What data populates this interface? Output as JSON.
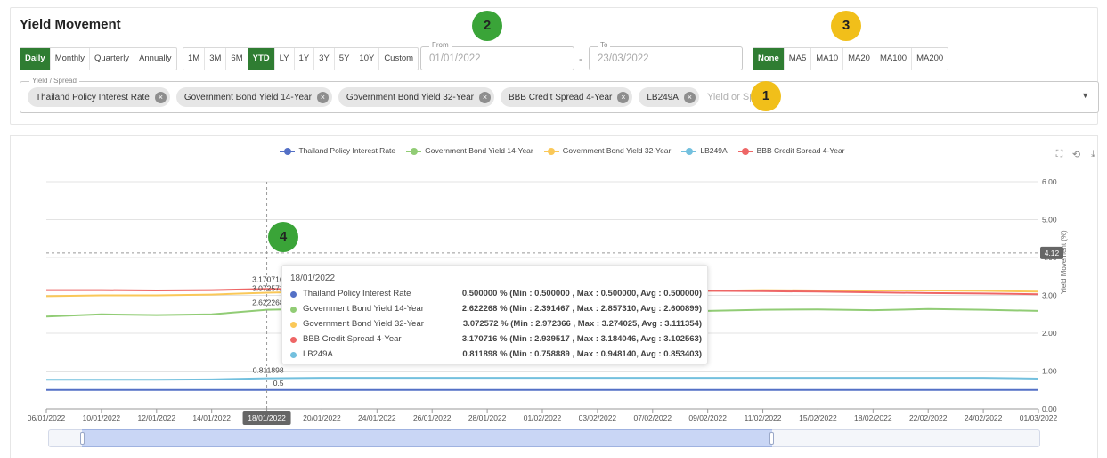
{
  "header": {
    "title": "Yield Movement"
  },
  "frequency_buttons": [
    "Daily",
    "Monthly",
    "Quarterly",
    "Annually"
  ],
  "frequency_active": "Daily",
  "period_buttons": [
    "1M",
    "3M",
    "6M",
    "YTD",
    "LY",
    "1Y",
    "3Y",
    "5Y",
    "10Y",
    "Custom"
  ],
  "period_active": "YTD",
  "date_range": {
    "from_label": "From",
    "from_value": "01/01/2022",
    "to_label": "To",
    "to_value": "23/03/2022",
    "separator": "-"
  },
  "moving_average_buttons": [
    "None",
    "MA5",
    "MA10",
    "MA20",
    "MA100",
    "MA200"
  ],
  "moving_average_active": "None",
  "yield_selector": {
    "label": "Yield / Spread",
    "placeholder": "Yield or Spread",
    "chips": [
      "Thailand Policy Interest Rate",
      "Government Bond Yield 14-Year",
      "Government Bond Yield 32-Year",
      "BBB Credit Spread 4-Year",
      "LB249A"
    ],
    "remove_icon": "close-circle-icon",
    "dropdown_icon": "caret-down-icon"
  },
  "annotations": [
    {
      "number": "1",
      "color": "#f1bf1a"
    },
    {
      "number": "2",
      "color": "#3aa438"
    },
    {
      "number": "3",
      "color": "#f1bf1a"
    },
    {
      "number": "4",
      "color": "#3aa438"
    }
  ],
  "toolbox": {
    "icons": [
      "zoom-icon",
      "zoom-reset-icon",
      "download-icon"
    ],
    "glyphs": [
      "⛶",
      "⟲",
      "⤓"
    ]
  },
  "chart_data": {
    "type": "line",
    "ylabel": "Yield Movement (%)",
    "ylim": [
      0,
      6
    ],
    "yticks": [
      "6.00",
      "5.00",
      "4.00",
      "3.00",
      "2.00",
      "1.00",
      "0.00"
    ],
    "x": [
      "06/01/2022",
      "10/01/2022",
      "12/01/2022",
      "14/01/2022",
      "18/01/2022",
      "20/01/2022",
      "24/01/2022",
      "26/01/2022",
      "28/01/2022",
      "01/02/2022",
      "03/02/2022",
      "07/02/2022",
      "09/02/2022",
      "11/02/2022",
      "15/02/2022",
      "18/02/2022",
      "22/02/2022",
      "24/02/2022",
      "01/03/2022"
    ],
    "series": [
      {
        "name": "Thailand Policy Interest Rate",
        "color": "#5470c6",
        "values": [
          0.5,
          0.5,
          0.5,
          0.5,
          0.5,
          0.5,
          0.5,
          0.5,
          0.5,
          0.5,
          0.5,
          0.5,
          0.5,
          0.5,
          0.5,
          0.5,
          0.5,
          0.5,
          0.5
        ]
      },
      {
        "name": "Government Bond Yield 14-Year",
        "color": "#91cc75",
        "values": [
          2.44,
          2.5,
          2.48,
          2.5,
          2.62,
          2.65,
          2.62,
          2.6,
          2.6,
          2.61,
          2.6,
          2.6,
          2.59,
          2.62,
          2.63,
          2.61,
          2.64,
          2.62,
          2.59
        ]
      },
      {
        "name": "Government Bond Yield 32-Year",
        "color": "#fac858",
        "values": [
          2.98,
          3.0,
          3.0,
          3.02,
          3.07,
          3.1,
          3.1,
          3.1,
          3.12,
          3.12,
          3.13,
          3.13,
          3.12,
          3.14,
          3.13,
          3.13,
          3.13,
          3.12,
          3.1
        ]
      },
      {
        "name": "LB249A",
        "color": "#73c0de",
        "values": [
          0.77,
          0.77,
          0.77,
          0.78,
          0.81,
          0.82,
          0.82,
          0.82,
          0.82,
          0.82,
          0.82,
          0.82,
          0.82,
          0.82,
          0.82,
          0.82,
          0.82,
          0.82,
          0.8
        ]
      },
      {
        "name": "BBB Credit Spread 4-Year",
        "color": "#ee6666",
        "values": [
          3.14,
          3.14,
          3.13,
          3.14,
          3.17,
          3.16,
          3.15,
          3.15,
          3.14,
          3.15,
          3.14,
          3.13,
          3.12,
          3.11,
          3.1,
          3.08,
          3.06,
          3.05,
          3.03
        ]
      }
    ],
    "legend_position": "top",
    "crosshair": {
      "x_label": "18/01/2022",
      "y_label": "4.12"
    },
    "point_labels": [
      "3.170716",
      "3.072572",
      "2.622268",
      "0.811898",
      "0.5"
    ],
    "tooltip": {
      "date": "18/01/2022",
      "rows": [
        {
          "name": "Thailand Policy Interest Rate",
          "color": "#5470c6",
          "value": "0.500000 % (Min : 0.500000 , Max : 0.500000, Avg : 0.500000)"
        },
        {
          "name": "Government Bond Yield 14-Year",
          "color": "#91cc75",
          "value": "2.622268 % (Min : 2.391467 , Max : 2.857310, Avg : 2.600899)"
        },
        {
          "name": "Government Bond Yield 32-Year",
          "color": "#fac858",
          "value": "3.072572 % (Min : 2.972366 , Max : 3.274025, Avg : 3.111354)"
        },
        {
          "name": "BBB Credit Spread 4-Year",
          "color": "#ee6666",
          "value": "3.170716 % (Min : 2.939517 , Max : 3.184046, Avg : 3.102563)"
        },
        {
          "name": "LB249A",
          "color": "#73c0de",
          "value": "0.811898 % (Min : 0.758889 , Max : 0.948140, Avg : 0.853403)"
        }
      ]
    },
    "zoom_slider": {
      "start_fraction": 0.034,
      "end_fraction": 0.73
    }
  }
}
